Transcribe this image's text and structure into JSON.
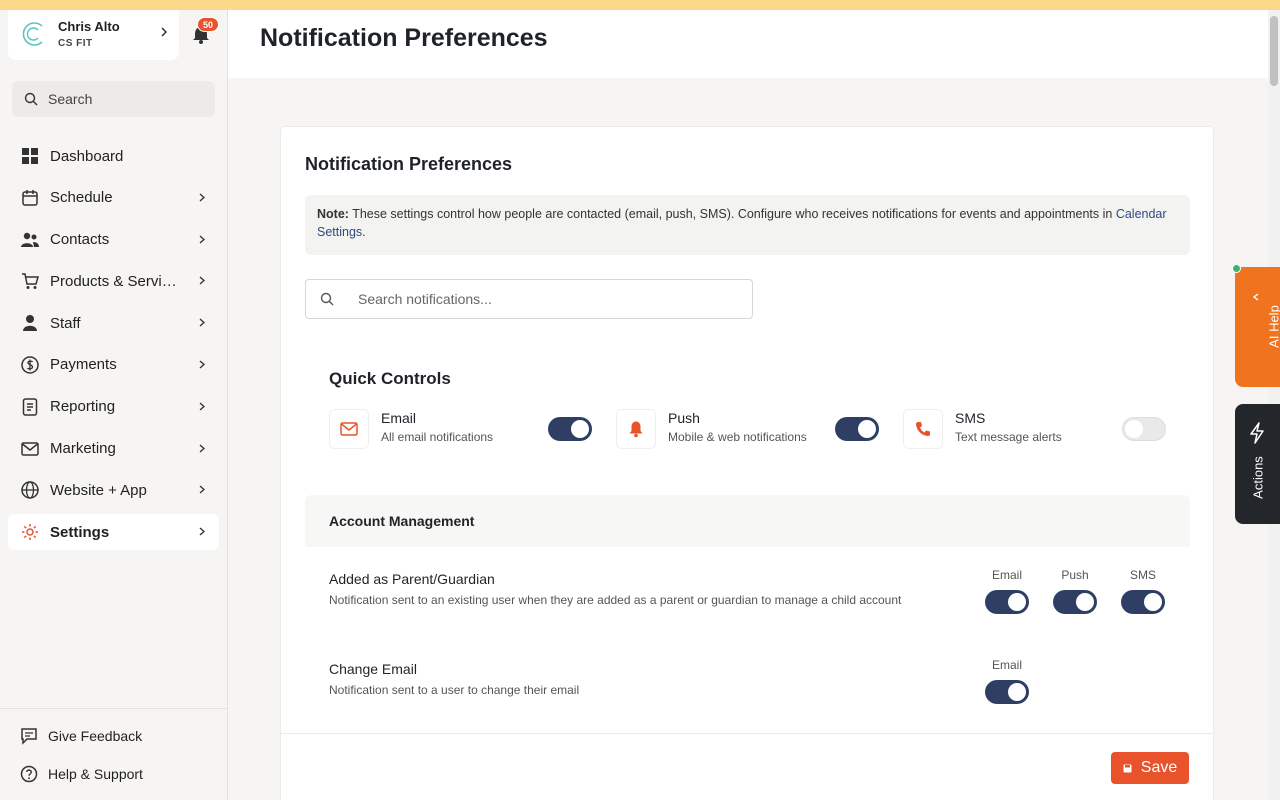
{
  "account": {
    "name": "Chris Alto",
    "org": "CS FIT",
    "notification_count": "50"
  },
  "sidebar": {
    "search_placeholder": "Search",
    "items": [
      {
        "label": "Dashboard",
        "icon": "dashboard-icon"
      },
      {
        "label": "Schedule",
        "icon": "calendar-icon"
      },
      {
        "label": "Contacts",
        "icon": "contacts-icon"
      },
      {
        "label": "Products & Services",
        "icon": "cart-icon"
      },
      {
        "label": "Staff",
        "icon": "person-icon"
      },
      {
        "label": "Payments",
        "icon": "dollar-icon"
      },
      {
        "label": "Reporting",
        "icon": "report-icon"
      },
      {
        "label": "Marketing",
        "icon": "mail-icon"
      },
      {
        "label": "Website + App",
        "icon": "globe-icon"
      },
      {
        "label": "Settings",
        "icon": "gear-icon",
        "active": true
      }
    ],
    "feedback_label": "Give Feedback",
    "help_label": "Help & Support"
  },
  "page": {
    "title": "Notification Preferences",
    "card_title": "Notification Preferences",
    "note": {
      "prefix": "Note:",
      "text": " These settings control how people are contacted (email, push, SMS). Configure who receives notifications for events and appointments in ",
      "link": "Calendar Settings",
      "suffix": "."
    },
    "search_placeholder": "Search notifications...",
    "quick_controls": {
      "title": "Quick Controls",
      "items": [
        {
          "title": "Email",
          "subtitle": "All email notifications",
          "on": true
        },
        {
          "title": "Push",
          "subtitle": "Mobile & web notifications",
          "on": true
        },
        {
          "title": "SMS",
          "subtitle": "Text message alerts",
          "on": false
        }
      ]
    },
    "section": {
      "title": "Account Management",
      "rows": [
        {
          "title": "Added as Parent/Guardian",
          "desc": "Notification sent to an existing user when they are added as a parent or guardian to manage a child account",
          "channels": [
            {
              "label": "Email",
              "on": true
            },
            {
              "label": "Push",
              "on": true
            },
            {
              "label": "SMS",
              "on": true
            }
          ]
        },
        {
          "title": "Change Email",
          "desc": "Notification sent to a user to change their email",
          "channels": [
            {
              "label": "Email",
              "on": true
            }
          ]
        }
      ]
    },
    "save_label": "Save"
  },
  "floating": {
    "ai_help": "AI Help",
    "actions": "Actions"
  },
  "colors": {
    "accent": "#e8532b",
    "toggle_on": "#2e3f63",
    "ai_help": "#f0741f",
    "actions": "#23262b",
    "top_bar": "#fcd98a"
  }
}
